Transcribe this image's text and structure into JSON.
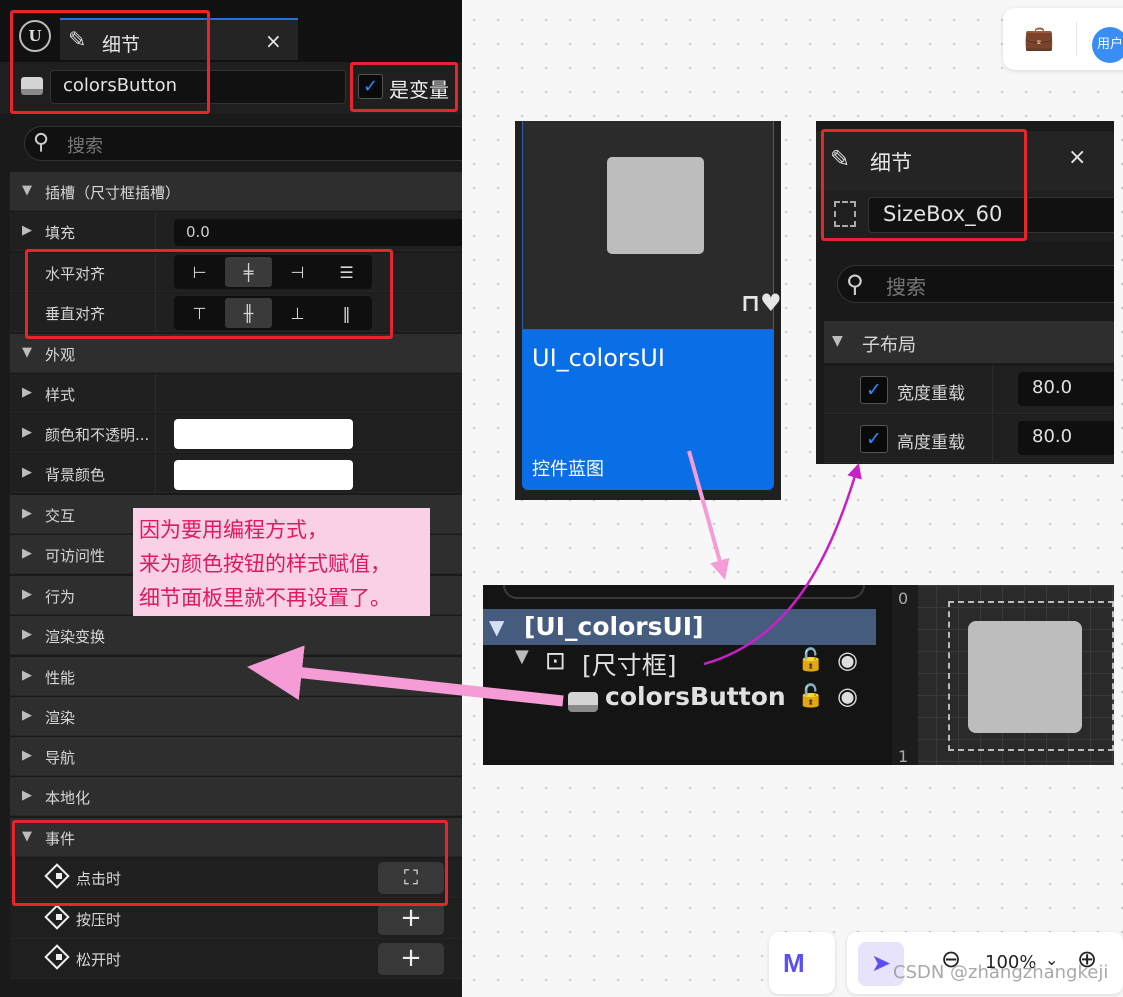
{
  "left_panel": {
    "tab_title": "细节",
    "tab_close": "×",
    "widget_name": "colorsButton",
    "is_variable_label": "是变量",
    "is_variable_checked": true,
    "search_placeholder": "搜索",
    "slot_section": "插槽（尺寸框插槽）",
    "fill_label": "填充",
    "fill_value": "0.0",
    "h_align_label": "水平对齐",
    "v_align_label": "垂直对齐",
    "appearance_section": "外观",
    "style_label": "样式",
    "color_opacity_label": "颜色和不透明...",
    "background_color_label": "背景颜色",
    "interaction_label": "交互",
    "accessibility_label": "可访问性",
    "behavior_label": "行为",
    "render_transform_label": "渲染变换",
    "performance_label": "性能",
    "rendering_label": "渲染",
    "navigation_label": "导航",
    "localization_label": "本地化",
    "events_section": "事件",
    "events": [
      {
        "label": "点击时",
        "button": "⛶"
      },
      {
        "label": "按压时",
        "button": "+"
      },
      {
        "label": "松开时",
        "button": "+"
      }
    ]
  },
  "blueprint_card": {
    "title": "UI_colorsUI",
    "subtitle": "控件蓝图"
  },
  "small_details": {
    "tab_title": "细节",
    "tab_close": "×",
    "widget_name": "SizeBox_60",
    "search_placeholder": "搜索",
    "section": "子布局",
    "width_override_label": "宽度重载",
    "width_override_value": "80.0",
    "height_override_label": "高度重载",
    "height_override_value": "80.0"
  },
  "annotation": {
    "lines": [
      "因为要用编程方式，",
      "来为颜色按钮的样式赋值，",
      "细节面板里就不再设置了。"
    ]
  },
  "hierarchy": {
    "root": "[UI_colorsUI]",
    "size_box": "[尺寸框]",
    "button": "colorsButton",
    "ruler_top": "0",
    "ruler_bottom": "1"
  },
  "top_toolbar": {
    "avatar_text": "用户"
  },
  "bottom_toolbar": {
    "zoom": "100%"
  },
  "watermark": "CSDN @zhangzhangkeji",
  "colors": {
    "highlight_red": "#e8242c",
    "accent_blue": "#0a6ee6",
    "arrow_pink": "#f59bd5",
    "arrow_magenta": "#c91fc8",
    "annotation_text": "#e0185f"
  }
}
